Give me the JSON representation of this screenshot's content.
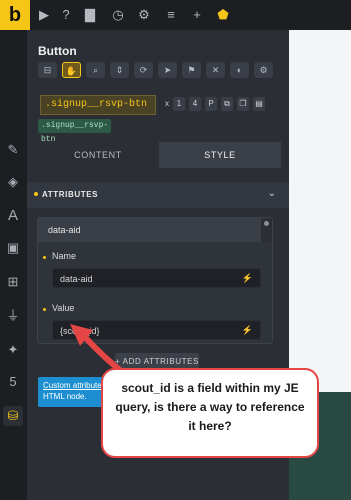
{
  "app": {
    "logo_letter": "b"
  },
  "topbar_icons": [
    {
      "name": "cursor-icon",
      "glyph": "▶"
    },
    {
      "name": "help-icon",
      "glyph": "?"
    },
    {
      "name": "page-icon",
      "glyph": "▇"
    },
    {
      "name": "history-icon",
      "glyph": "◷"
    },
    {
      "name": "settings-icon",
      "glyph": "⚙"
    },
    {
      "name": "sliders-icon",
      "glyph": "≡"
    },
    {
      "name": "add-icon",
      "glyph": "+"
    },
    {
      "name": "shield-icon",
      "glyph": "⬟"
    }
  ],
  "rail_icons": [
    {
      "name": "edit-icon",
      "glyph": "✎"
    },
    {
      "name": "layers-icon",
      "glyph": "◈"
    },
    {
      "name": "typography-icon",
      "glyph": "A"
    },
    {
      "name": "image-icon",
      "glyph": "▣"
    },
    {
      "name": "grid-icon",
      "glyph": "⊞"
    },
    {
      "name": "plug-icon",
      "glyph": "⏚"
    },
    {
      "name": "magic-wand-icon",
      "glyph": "✦"
    },
    {
      "name": "html5-icon",
      "glyph": "5"
    },
    {
      "name": "database-icon",
      "glyph": "⛁"
    }
  ],
  "panel": {
    "title": "Button",
    "class_chip": ".signup__rsvp-btn",
    "class_tag": ".signup__rsvp-btn",
    "class_buttons": [
      "x",
      "1",
      "4",
      "P"
    ],
    "tabs": [
      "CONTENT",
      "STYLE"
    ],
    "active_tab": "STYLE",
    "section_title": "ATTRIBUTES",
    "section_chevron": "⌄",
    "attribute": {
      "header": "data-aid",
      "name_label": "Name",
      "name_value": "data-aid",
      "value_label": "Value",
      "value_value": "{scout_id}"
    },
    "add_button": "+ ADD ATTRIBUTES",
    "info_text_link": "Custom attributes",
    "info_text_rest": " HTML node."
  },
  "bolt_glyph": "⚡",
  "annotation": {
    "text": "scout_id is a field within my JE query, is there a way to reference it here?"
  },
  "colors": {
    "accent": "#f5c518",
    "annotation_border": "#e44545",
    "info_blue": "#1d8fd1"
  }
}
